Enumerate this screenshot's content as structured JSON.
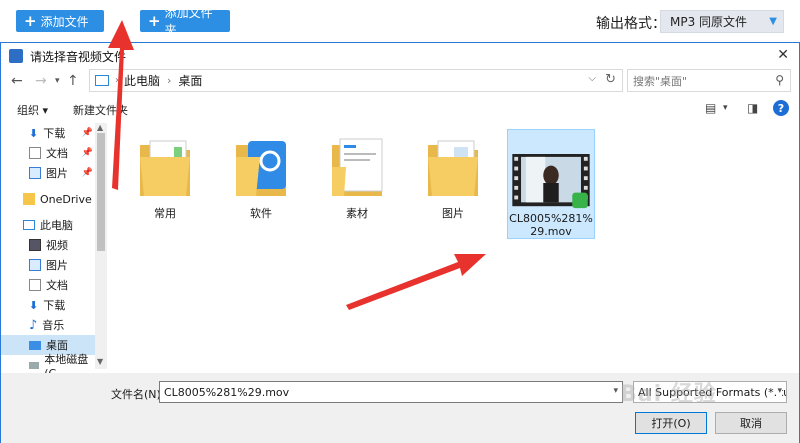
{
  "app_toolbar": {
    "add_file_label": "添加文件",
    "add_folder_label": "添加文件夹",
    "output_format_label": "输出格式：",
    "output_format_value": "MP3  同原文件"
  },
  "dialog": {
    "title": "请选择音视频文件",
    "breadcrumb": [
      "此电脑",
      "桌面"
    ],
    "search_placeholder": "搜索\"桌面\"",
    "organize_label": "组织 ▾",
    "new_folder_label": "新建文件夹"
  },
  "sidebar": {
    "items": [
      {
        "label": "下载",
        "icon": "download-arrow-icon",
        "pinned": true
      },
      {
        "label": "文档",
        "icon": "document-icon",
        "pinned": true
      },
      {
        "label": "图片",
        "icon": "picture-icon",
        "pinned": true
      },
      {
        "label": "OneDrive",
        "icon": "folder-icon",
        "pinned": false
      },
      {
        "label": "此电脑",
        "icon": "computer-icon",
        "pinned": false
      },
      {
        "label": "视频",
        "icon": "video-icon",
        "pinned": false
      },
      {
        "label": "图片",
        "icon": "picture-icon",
        "pinned": false
      },
      {
        "label": "文档",
        "icon": "document-icon",
        "pinned": false
      },
      {
        "label": "下载",
        "icon": "download-arrow-icon",
        "pinned": false
      },
      {
        "label": "音乐",
        "icon": "music-note-icon",
        "pinned": false
      },
      {
        "label": "桌面",
        "icon": "desktop-icon",
        "pinned": false
      },
      {
        "label": "本地磁盘 (C",
        "icon": "drive-icon",
        "pinned": false
      }
    ]
  },
  "files": [
    {
      "name": "常用",
      "type": "folder"
    },
    {
      "name": "软件",
      "type": "folder"
    },
    {
      "name": "素材",
      "type": "folder"
    },
    {
      "name": "图片",
      "type": "folder"
    },
    {
      "name": "CL8005%281%29.mov",
      "type": "video"
    }
  ],
  "bottom": {
    "filename_label": "文件名(N):",
    "filename_value": "CL8005%281%29.mov",
    "filter_value": "All Supported Formats (*.kux",
    "open_label": "打开(O)",
    "cancel_label": "取消"
  },
  "watermark": "Bai 经验",
  "colors": {
    "accent_blue": "#2d8fe3",
    "selection": "#cce8ff",
    "arrow_red": "#e8322d"
  }
}
